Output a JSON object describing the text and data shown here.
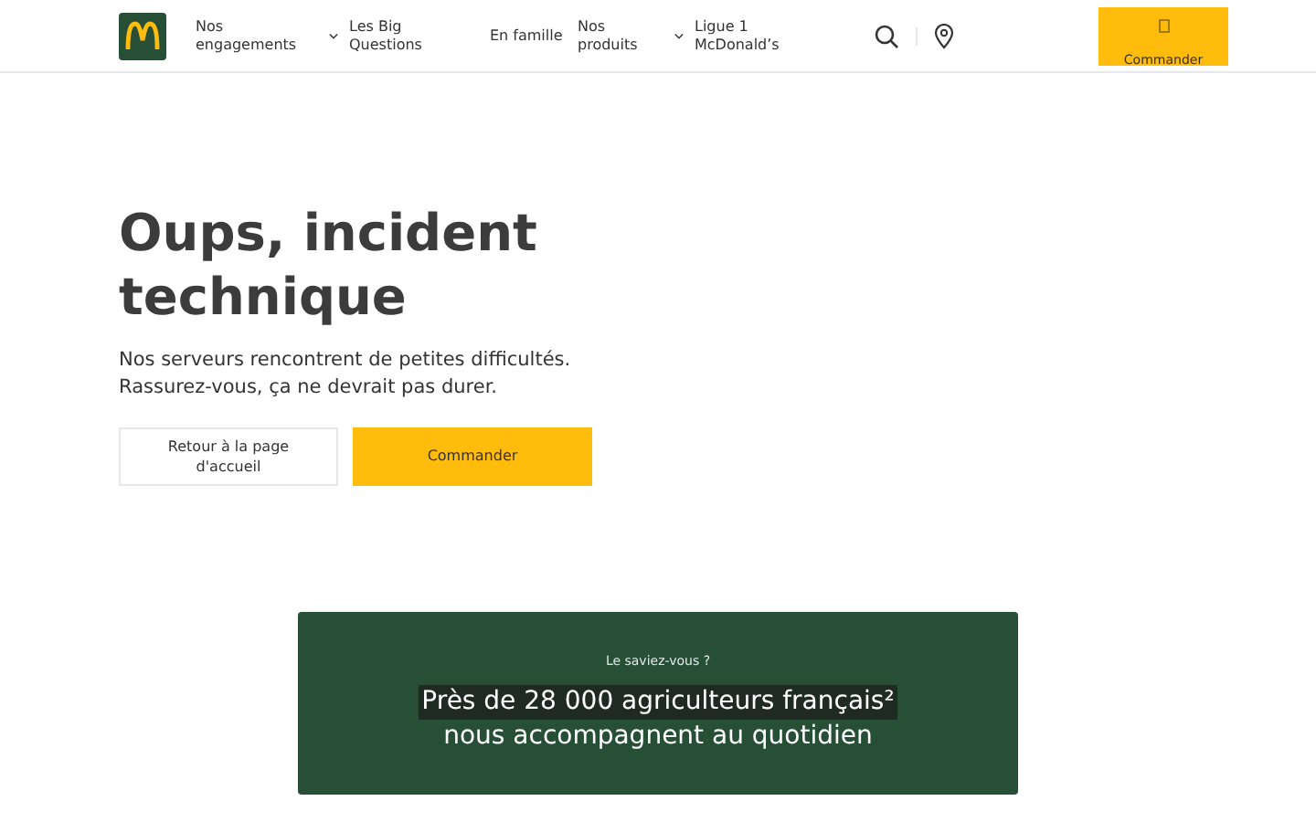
{
  "header": {
    "nav": [
      {
        "label": "Nos engagements",
        "dropdown": true
      },
      {
        "label": "Les Big Questions",
        "dropdown": false
      },
      {
        "label": "En famille",
        "dropdown": false
      },
      {
        "label": "Nos produits",
        "dropdown": true
      },
      {
        "label": "Ligue 1 McDonald’s",
        "dropdown": false
      }
    ],
    "order_button": "Commander"
  },
  "error": {
    "title": "Oups, incident technique",
    "message": "Nos serveurs rencontrent de petites difficultés. Rassurez-vous, ça ne devrait pas durer.",
    "buttons": [
      {
        "label": "Retour à la page d'accueil",
        "kind": "secondary"
      },
      {
        "label": "Commander",
        "kind": "primary"
      }
    ]
  },
  "fact": {
    "eyebrow": "Le saviez-vous ?",
    "lines": [
      {
        "text": "Près de 28 000 agriculteurs français²",
        "highlighted": true
      },
      {
        "text": "nous accompagnent au quotidien",
        "highlighted": false
      }
    ]
  }
}
